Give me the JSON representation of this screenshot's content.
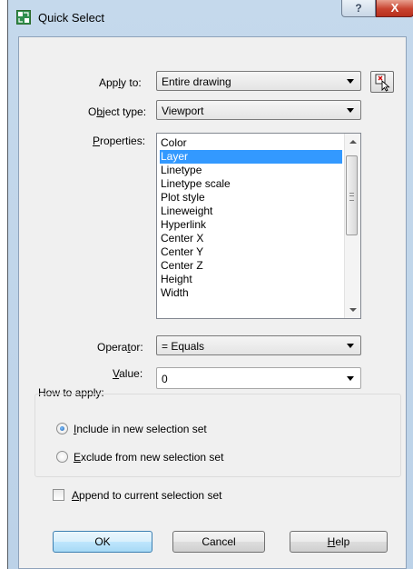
{
  "window": {
    "title": "Quick Select",
    "help_button": "?",
    "close_button": "X"
  },
  "apply_to": {
    "pre": "App",
    "accel": "l",
    "post": "y to:",
    "value": "Entire drawing"
  },
  "object_type": {
    "pre": "O",
    "accel": "b",
    "post": "ject type:",
    "value": "Viewport"
  },
  "properties": {
    "accel": "P",
    "post": "roperties:",
    "items": [
      "Color",
      "Layer",
      "Linetype",
      "Linetype scale",
      "Plot style",
      "Lineweight",
      "Hyperlink",
      "Center X",
      "Center Y",
      "Center Z",
      "Height",
      "Width"
    ],
    "selected": "Layer"
  },
  "operator": {
    "pre": "Opera",
    "accel": "t",
    "post": "or:",
    "value": "= Equals"
  },
  "value": {
    "accel": "V",
    "post": "alue:",
    "value": "0"
  },
  "how_to_apply": {
    "title": "How to apply:",
    "include": {
      "accel": "I",
      "post": "nclude in new selection set",
      "checked": true
    },
    "exclude": {
      "accel": "E",
      "post": "xclude from new selection set",
      "checked": false
    }
  },
  "append": {
    "accel": "A",
    "post": "ppend to current selection set",
    "checked": false
  },
  "buttons": {
    "ok": "OK",
    "cancel": "Cancel",
    "help_accel": "H",
    "help_post": "elp"
  },
  "colors": {
    "selection": "#3399ff",
    "title_bar": "#c5d9ec",
    "dialog_bg": "#f0f0f0",
    "close_red": "#c8432f"
  }
}
